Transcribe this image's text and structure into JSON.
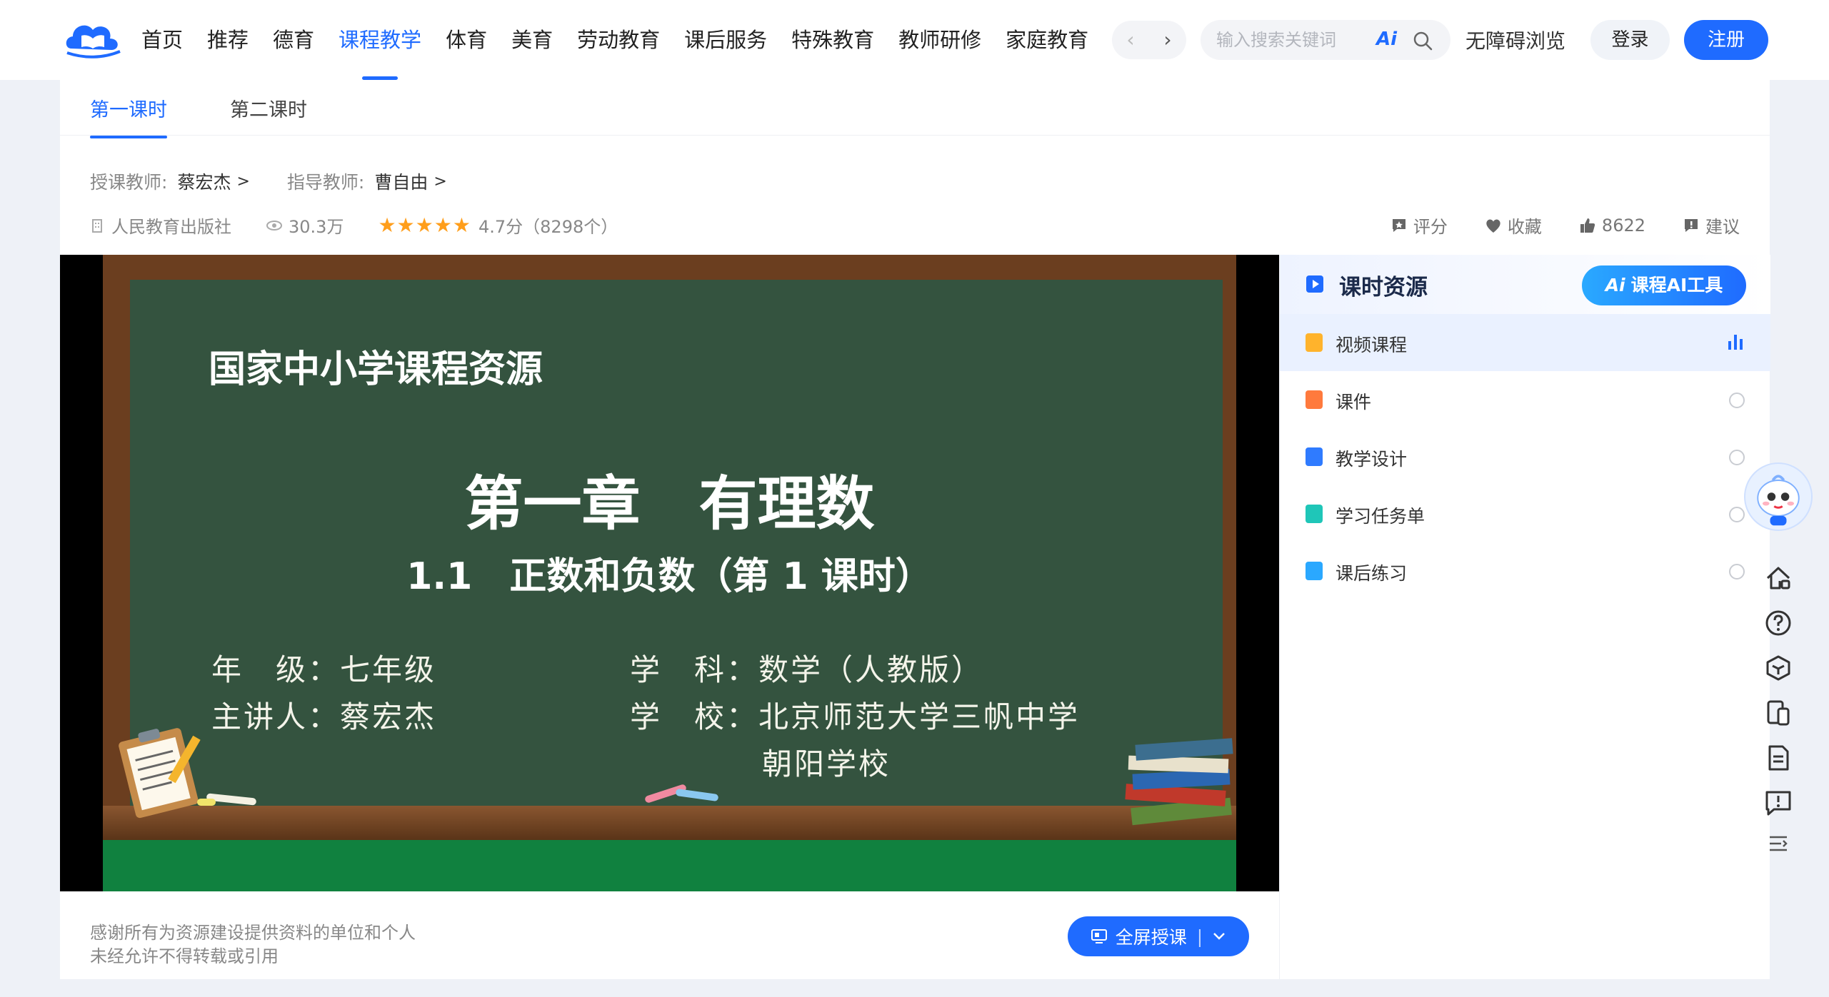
{
  "header": {
    "nav": [
      "首页",
      "推荐",
      "德育",
      "课程教学",
      "体育",
      "美育",
      "劳动教育",
      "课后服务",
      "特殊教育",
      "教师研修",
      "家庭教育"
    ],
    "active_nav": 3,
    "prev_arrow": "‹",
    "next_arrow": "›",
    "search_placeholder": "输入搜索关键词",
    "ai_badge": "Ai",
    "accessible": "无障碍浏览",
    "login": "登录",
    "register": "注册"
  },
  "lesson_tabs": [
    "第一课时",
    "第二课时"
  ],
  "teachers": {
    "lecturer_label": "授课教师:",
    "lecturer": "蔡宏杰",
    "advisor_label": "指导教师:",
    "advisor": "曹自由"
  },
  "meta": {
    "publisher": "人民教育出版社",
    "views": "30.3万",
    "rating": "4.7分（8298个）"
  },
  "actions": {
    "rate": "评分",
    "favorite": "收藏",
    "likes": "8622",
    "suggest": "建议"
  },
  "video": {
    "source": "国家中小学课程资源",
    "chapter": "第一章　有理数",
    "section": "1.1　正数和负数（第 1 课时）",
    "grade": "年　级：七年级",
    "subject": "学　科：数学（人教版）",
    "speaker": "主讲人：蔡宏杰",
    "school_line1": "学　校：北京师范大学三帆中学",
    "school_line2": "朝阳学校"
  },
  "sidebar": {
    "title": "课时资源",
    "ai_tool": "课程AI工具",
    "items": [
      {
        "label": "视频课程",
        "color": "#ffb32c"
      },
      {
        "label": "课件",
        "color": "#ff7a3d"
      },
      {
        "label": "教学设计",
        "color": "#2f7bff"
      },
      {
        "label": "学习任务单",
        "color": "#1fc6b8"
      },
      {
        "label": "课后练习",
        "color": "#2aa8ff"
      }
    ]
  },
  "footer": {
    "thanks": "感谢所有为资源建设提供资料的单位和个人",
    "copyright": "未经允许不得转载或引用",
    "fullscreen": "全屏授课",
    "separator": "|"
  },
  "colors": {
    "accent": "#1f6bff",
    "star": "#ff9e1b",
    "board": "#34533f"
  }
}
